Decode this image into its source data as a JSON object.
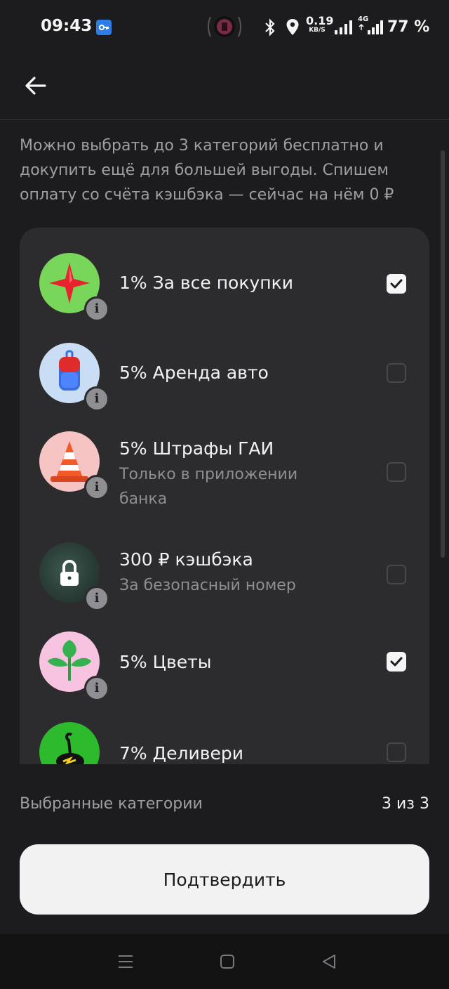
{
  "status_bar": {
    "time": "09:43",
    "net_speed_value": "0.19",
    "net_speed_unit": "KB/S",
    "network_type": "4G",
    "battery": "77 %"
  },
  "intro_text": "Можно выбрать до 3 категорий бесплатно и докупить ещё для большей выгоды. Спишем оплату со счёта кэшбэка — сейчас на нём 0 ₽",
  "categories": [
    {
      "title": "1% За все покупки",
      "subtitle": "",
      "checked": true,
      "icon": "star-icon"
    },
    {
      "title": "5% Аренда авто",
      "subtitle": "",
      "checked": false,
      "icon": "car-rental-icon"
    },
    {
      "title": "5% Штрафы ГАИ",
      "subtitle": "Только в приложении банка",
      "checked": false,
      "icon": "traffic-cone-icon"
    },
    {
      "title": "300 ₽ кэшбэка",
      "subtitle": "За безопасный номер",
      "checked": false,
      "icon": "lock-icon"
    },
    {
      "title": "5% Цветы",
      "subtitle": "",
      "checked": true,
      "icon": "flower-icon"
    },
    {
      "title": "7% Деливери",
      "subtitle": "",
      "checked": false,
      "icon": "delivery-ostrich-icon"
    }
  ],
  "footer": {
    "selected_label": "Выбранные категории",
    "selected_count": "3 из 3",
    "confirm_label": "Подтвердить"
  },
  "colors": {
    "background": "#1c1c1e",
    "card": "#2c2c2e",
    "button": "#f2f2f2",
    "secondary_text": "#8e8e93"
  }
}
